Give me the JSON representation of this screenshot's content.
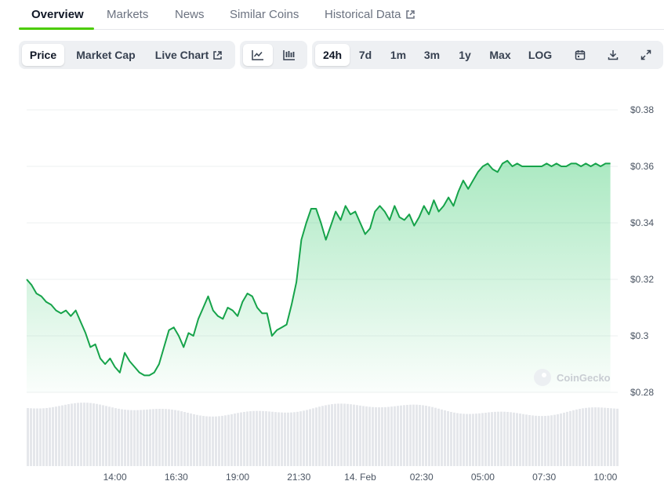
{
  "nav": {
    "tabs": [
      {
        "label": "Overview",
        "active": true
      },
      {
        "label": "Markets"
      },
      {
        "label": "News"
      },
      {
        "label": "Similar Coins"
      },
      {
        "label": "Historical Data",
        "external": true
      }
    ]
  },
  "toolbar": {
    "metric_tabs": [
      "Price",
      "Market Cap",
      "Live Chart"
    ],
    "selected_metric": "Price",
    "chart_styles": [
      "line-chart-icon",
      "candlestick-icon"
    ],
    "selected_style": "line-chart-icon",
    "ranges": [
      "24h",
      "7d",
      "1m",
      "3m",
      "1y",
      "Max",
      "LOG"
    ],
    "selected_range": "24h",
    "tools": [
      "calendar-icon",
      "download-icon",
      "expand-icon"
    ]
  },
  "watermark": "CoinGecko",
  "colors": {
    "line": "#16a34a",
    "fill_top": "#22c55e",
    "volume": "#e5e7eb",
    "accent": "#4bcc00"
  },
  "chart_data": {
    "type": "area",
    "title": "",
    "xlabel": "",
    "ylabel": "",
    "ylim": [
      0.28,
      0.38
    ],
    "y_ticks": [
      "$0.38",
      "$0.36",
      "$0.34",
      "$0.32",
      "$0.3",
      "$0.28"
    ],
    "y_tick_values": [
      0.38,
      0.36,
      0.34,
      0.32,
      0.3,
      0.28
    ],
    "x_ticks": [
      "14:00",
      "16:30",
      "19:00",
      "21:30",
      "14. Feb",
      "02:30",
      "05:00",
      "07:30",
      "10:00"
    ],
    "x_tick_hours": [
      14.0,
      16.5,
      19.0,
      21.5,
      24.0,
      26.5,
      29.0,
      31.5,
      34.0
    ],
    "x_range_hours": [
      10.4,
      34.5
    ],
    "grid": true,
    "series": [
      {
        "x": [
          10.4,
          10.6,
          10.8,
          11.0,
          11.2,
          11.4,
          11.6,
          11.8,
          12.0,
          12.2,
          12.4,
          12.6,
          12.8,
          13.0,
          13.2,
          13.4,
          13.6,
          13.8,
          14.0,
          14.2,
          14.4,
          14.6,
          14.8,
          15.0,
          15.2,
          15.4,
          15.6,
          15.8,
          16.0,
          16.2,
          16.4,
          16.6,
          16.8,
          17.0,
          17.2,
          17.4,
          17.6,
          17.8,
          18.0,
          18.2,
          18.4,
          18.6,
          18.8,
          19.0,
          19.2,
          19.4,
          19.6,
          19.8,
          20.0,
          20.2,
          20.4,
          20.6,
          20.8,
          21.0,
          21.2,
          21.4,
          21.6,
          21.8,
          22.0,
          22.2,
          22.4,
          22.6,
          22.8,
          23.0,
          23.2,
          23.4,
          23.6,
          23.8,
          24.0,
          24.2,
          24.4,
          24.6,
          24.8,
          25.0,
          25.2,
          25.4,
          25.6,
          25.8,
          26.0,
          26.2,
          26.4,
          26.6,
          26.8,
          27.0,
          27.2,
          27.4,
          27.6,
          27.8,
          28.0,
          28.2,
          28.4,
          28.6,
          28.8,
          29.0,
          29.2,
          29.4,
          29.6,
          29.8,
          30.0,
          30.2,
          30.4,
          30.6,
          30.8,
          31.0,
          31.2,
          31.4,
          31.6,
          31.8,
          32.0,
          32.2,
          32.4,
          32.6,
          32.8,
          33.0,
          33.2,
          33.4,
          33.6,
          33.8,
          34.0,
          34.2
        ],
        "values": [
          0.32,
          0.318,
          0.315,
          0.314,
          0.312,
          0.311,
          0.309,
          0.308,
          0.309,
          0.307,
          0.309,
          0.305,
          0.301,
          0.296,
          0.297,
          0.292,
          0.29,
          0.292,
          0.289,
          0.287,
          0.294,
          0.291,
          0.289,
          0.287,
          0.286,
          0.286,
          0.287,
          0.29,
          0.296,
          0.302,
          0.303,
          0.3,
          0.296,
          0.301,
          0.3,
          0.306,
          0.31,
          0.314,
          0.309,
          0.307,
          0.306,
          0.31,
          0.309,
          0.307,
          0.312,
          0.315,
          0.314,
          0.31,
          0.308,
          0.308,
          0.3,
          0.302,
          0.303,
          0.304,
          0.311,
          0.319,
          0.334,
          0.34,
          0.345,
          0.345,
          0.34,
          0.334,
          0.339,
          0.344,
          0.341,
          0.346,
          0.343,
          0.344,
          0.34,
          0.336,
          0.338,
          0.344,
          0.346,
          0.344,
          0.341,
          0.346,
          0.342,
          0.341,
          0.343,
          0.339,
          0.342,
          0.346,
          0.343,
          0.348,
          0.344,
          0.346,
          0.349,
          0.346,
          0.351,
          0.355,
          0.352,
          0.355,
          0.358,
          0.36,
          0.361,
          0.359,
          0.358,
          0.361,
          0.362,
          0.36,
          0.361,
          0.36,
          0.36,
          0.36,
          0.36,
          0.36,
          0.361,
          0.36,
          0.361,
          0.36,
          0.36,
          0.361,
          0.361,
          0.36,
          0.361,
          0.36,
          0.361,
          0.36,
          0.361,
          0.361
        ]
      }
    ]
  }
}
